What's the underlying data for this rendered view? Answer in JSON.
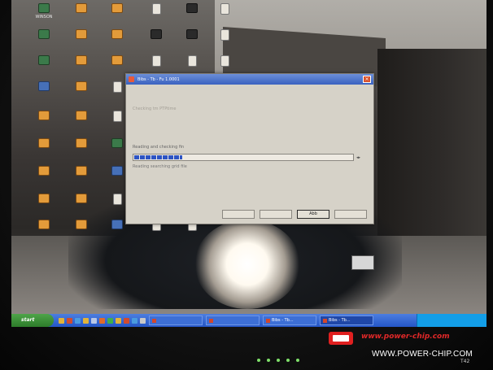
{
  "dialog": {
    "title": "Bibs - Tb - Fu 1.0001",
    "faint_lines": [
      "",
      ""
    ],
    "message_faint": "Checking tm PTPtime",
    "status": "Reading and checking fin",
    "sub_status": "Reading searching grid file",
    "progress": 0.22,
    "buttons": [
      "",
      "",
      "Abb",
      ""
    ]
  },
  "desktop": {
    "icons": [
      {
        "label": "WINSON",
        "kind": "app"
      },
      {
        "label": "",
        "kind": "folder"
      },
      {
        "label": "",
        "kind": "folder"
      },
      {
        "label": "",
        "kind": "doc"
      },
      {
        "label": "",
        "kind": "dark"
      },
      {
        "label": "",
        "kind": "doc"
      },
      {
        "label": "",
        "kind": "app"
      },
      {
        "label": "",
        "kind": "folder"
      },
      {
        "label": "",
        "kind": "folder"
      },
      {
        "label": "",
        "kind": "dark"
      },
      {
        "label": "",
        "kind": "dark"
      },
      {
        "label": "",
        "kind": "doc"
      },
      {
        "label": "",
        "kind": "app"
      },
      {
        "label": "",
        "kind": "folder"
      },
      {
        "label": "",
        "kind": "folder"
      },
      {
        "label": "",
        "kind": "doc"
      },
      {
        "label": "",
        "kind": "doc"
      },
      {
        "label": "",
        "kind": "doc"
      },
      {
        "label": "",
        "kind": "blue"
      },
      {
        "label": "",
        "kind": "folder"
      },
      {
        "label": "",
        "kind": "doc"
      },
      {
        "label": "",
        "kind": "folder"
      },
      {
        "label": "",
        "kind": "folder"
      },
      {
        "label": "",
        "kind": "doc"
      },
      {
        "label": "",
        "kind": "folder"
      },
      {
        "label": "",
        "kind": "folder"
      },
      {
        "label": "",
        "kind": "app"
      },
      {
        "label": "",
        "kind": "folder"
      },
      {
        "label": "",
        "kind": "folder"
      },
      {
        "label": "",
        "kind": "blue"
      },
      {
        "label": "",
        "kind": "folder"
      },
      {
        "label": "",
        "kind": "folder"
      },
      {
        "label": "",
        "kind": "doc"
      },
      {
        "label": "",
        "kind": "doc"
      },
      {
        "label": "",
        "kind": "folder"
      },
      {
        "label": "",
        "kind": "folder"
      },
      {
        "label": "",
        "kind": "blue"
      },
      {
        "label": "",
        "kind": "doc"
      },
      {
        "label": "",
        "kind": "doc"
      }
    ]
  },
  "taskbar": {
    "start_label": "start",
    "quicklaunch_colors": [
      "#e2b33a",
      "#d14b2e",
      "#4a9be0",
      "#e2b33a",
      "#b8c7e6",
      "#e06a2a",
      "#3fb04a",
      "#e2b33a",
      "#d14b2e",
      "#4a9be0",
      "#c9c9c9"
    ],
    "tasks": [
      {
        "label": "",
        "active": false
      },
      {
        "label": "",
        "active": false
      },
      {
        "label": "Bibs - Tb...",
        "active": false
      },
      {
        "label": "Bibs - Tb...",
        "active": true
      }
    ],
    "clock": ""
  },
  "watermark": {
    "url_red": "www.power-chip.com",
    "url_white": "WWW.POWER-CHIP.COM",
    "logo_color": "#e02020"
  },
  "bezel": {
    "model": "T42"
  },
  "colors": {
    "titlebar": "#3a62c0",
    "progress": "#2d54c4",
    "taskbar": "#2455c6",
    "start": "#2d7c2a"
  }
}
